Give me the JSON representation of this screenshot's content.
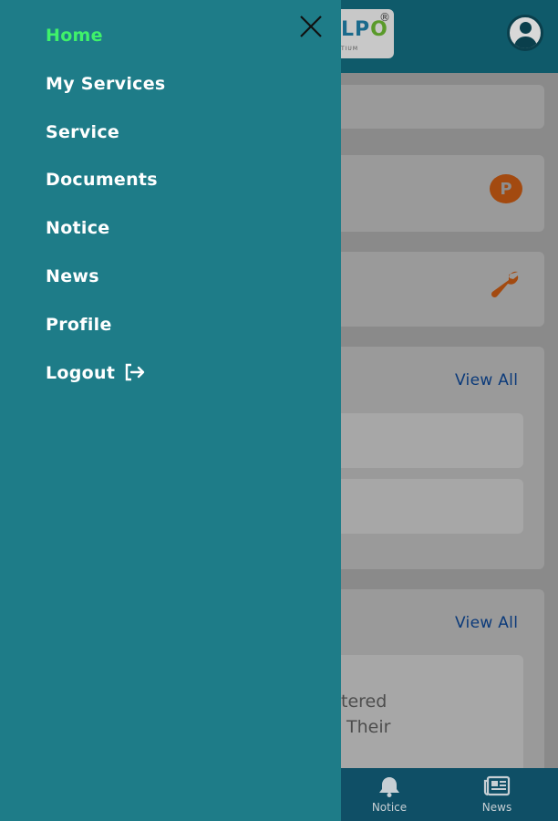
{
  "logo": {
    "text_main": "LPO",
    "text_accent_o": "",
    "registered": "®",
    "subtitle": "TIUM"
  },
  "main": {
    "cards": [
      {
        "view_all": "View All"
      },
      {
        "view_all": "View All"
      }
    ],
    "parking_icon_letter": "P",
    "notice_snippet_line1": "tered",
    "notice_snippet_line2": "Their"
  },
  "bottom_nav": {
    "items": [
      {
        "label": "Notice",
        "icon": "bell-icon"
      },
      {
        "label": "News",
        "icon": "newspaper-icon"
      }
    ]
  },
  "drawer": {
    "items": [
      {
        "label": "Home",
        "active": true
      },
      {
        "label": "My Services"
      },
      {
        "label": "Service"
      },
      {
        "label": "Documents"
      },
      {
        "label": "Notice"
      },
      {
        "label": "News"
      },
      {
        "label": "Profile"
      },
      {
        "label": "Logout",
        "icon": "logout-icon"
      }
    ],
    "active_color": "#3ff26a",
    "background_color": "#1e7c88"
  }
}
